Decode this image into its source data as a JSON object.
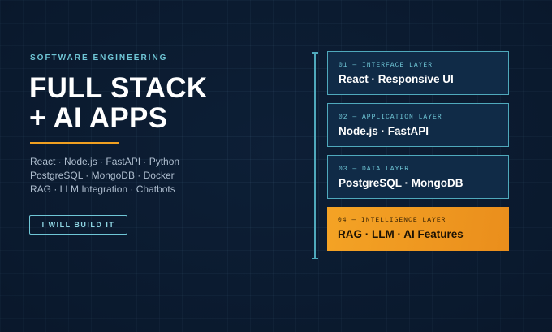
{
  "hero": {
    "eyebrow": "SOFTWARE ENGINEERING",
    "title_line1": "FULL STACK",
    "title_line2": "+ AI APPS",
    "tech_lines": [
      "React · Node.js · FastAPI · Python",
      "PostgreSQL · MongoDB · Docker",
      "RAG · LLM Integration · Chatbots"
    ],
    "cta_label": "I WILL BUILD IT"
  },
  "stack": {
    "layers": [
      {
        "label": "01 — INTERFACE LAYER",
        "name": "React · Responsive UI"
      },
      {
        "label": "02 — APPLICATION LAYER",
        "name": "Node.js · FastAPI"
      },
      {
        "label": "03 — DATA LAYER",
        "name": "PostgreSQL · MongoDB"
      },
      {
        "label": "04 — INTELLIGENCE LAYER",
        "name": "RAG · LLM · AI Features"
      }
    ]
  },
  "colors": {
    "background": "#0d1f36",
    "accent_teal": "#6fc6d6",
    "accent_orange": "#f0a021",
    "layer_fill": "#102b47"
  }
}
